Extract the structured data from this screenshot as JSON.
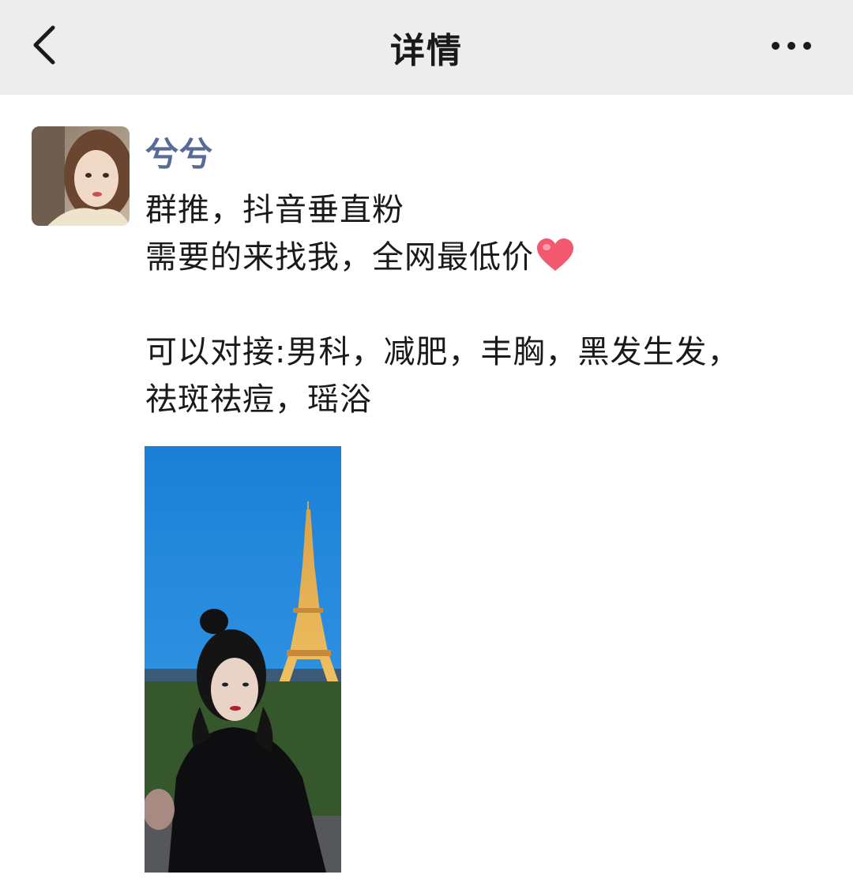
{
  "header": {
    "title": "详情",
    "back_icon": "chevron-left-icon",
    "more_icon": "ellipsis-icon"
  },
  "post": {
    "author": "兮兮",
    "lines": [
      "群推，抖音垂直粉",
      "需要的来找我，全网最低价",
      "",
      "可以对接:男科，减肥，丰胸，黑发生发，",
      "祛斑祛痘，瑶浴"
    ],
    "emoji": "heart-emoji-icon"
  },
  "colors": {
    "header_bg": "#ededed",
    "author_name": "#576b95",
    "text": "#1a1a1a",
    "sky": "#1d86d8",
    "heart": "#f2586e"
  }
}
